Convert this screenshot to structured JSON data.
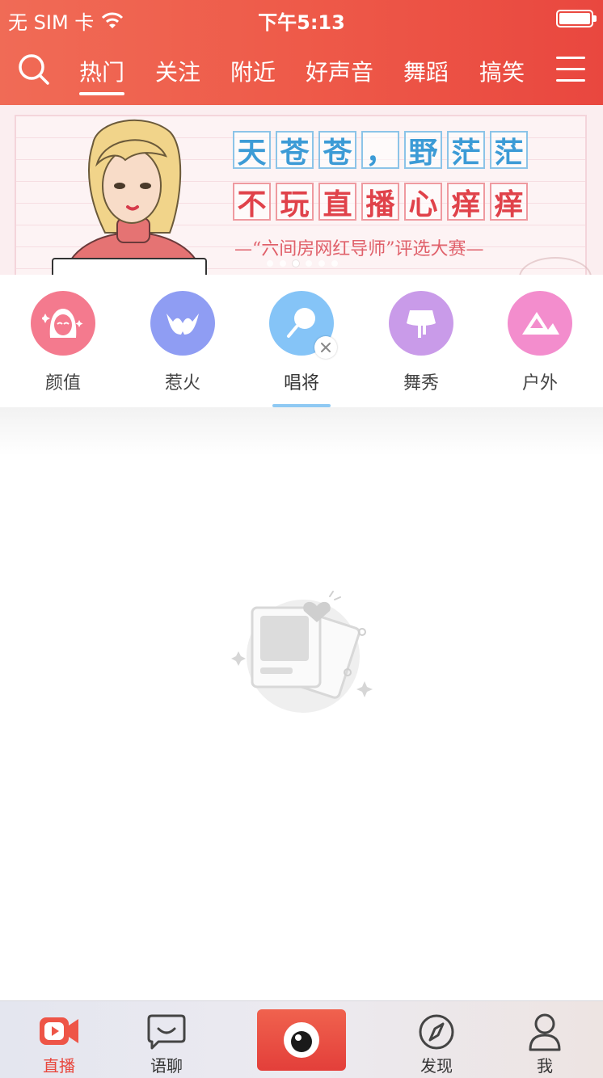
{
  "status_bar": {
    "carrier": "无 SIM 卡",
    "time": "下午5:13"
  },
  "nav": {
    "tabs": [
      {
        "label": "热门",
        "active": true
      },
      {
        "label": "关注",
        "active": false
      },
      {
        "label": "附近",
        "active": false
      },
      {
        "label": "好声音",
        "active": false
      },
      {
        "label": "舞蹈",
        "active": false
      },
      {
        "label": "搞笑",
        "active": false
      }
    ]
  },
  "banner": {
    "line1": [
      "天",
      "苍",
      "苍",
      "，",
      "野",
      "茫",
      "茫"
    ],
    "line2": [
      "不",
      "玩",
      "直",
      "播",
      "心",
      "痒",
      "痒"
    ],
    "subtitle": "—“六间房网红导师”评选大赛—",
    "dots": 6,
    "active_dot": 2
  },
  "categories": [
    {
      "label": "颜值",
      "color": "#f47a8e",
      "icon": "face-icon"
    },
    {
      "label": "惹火",
      "color": "#8f9df3",
      "icon": "bikini-icon"
    },
    {
      "label": "唱将",
      "color": "#85c4f7",
      "icon": "microphone-icon",
      "active": true
    },
    {
      "label": "舞秀",
      "color": "#c99be9",
      "icon": "skirt-icon"
    },
    {
      "label": "户外",
      "color": "#f38dcd",
      "icon": "mountain-icon"
    }
  ],
  "tabbar": {
    "items": [
      {
        "label": "直播",
        "icon": "live-camera-icon",
        "active": true
      },
      {
        "label": "语聊",
        "icon": "chat-bubble-icon",
        "active": false
      },
      {
        "label": "",
        "icon": "eye-icon",
        "active": false
      },
      {
        "label": "发现",
        "icon": "compass-icon",
        "active": false
      },
      {
        "label": "我",
        "icon": "profile-icon",
        "active": false
      }
    ]
  },
  "colors": {
    "header_start": "#f06b56",
    "header_end": "#e9473f",
    "accent": "#e8473d",
    "category_underline": "#8fc9f3"
  }
}
